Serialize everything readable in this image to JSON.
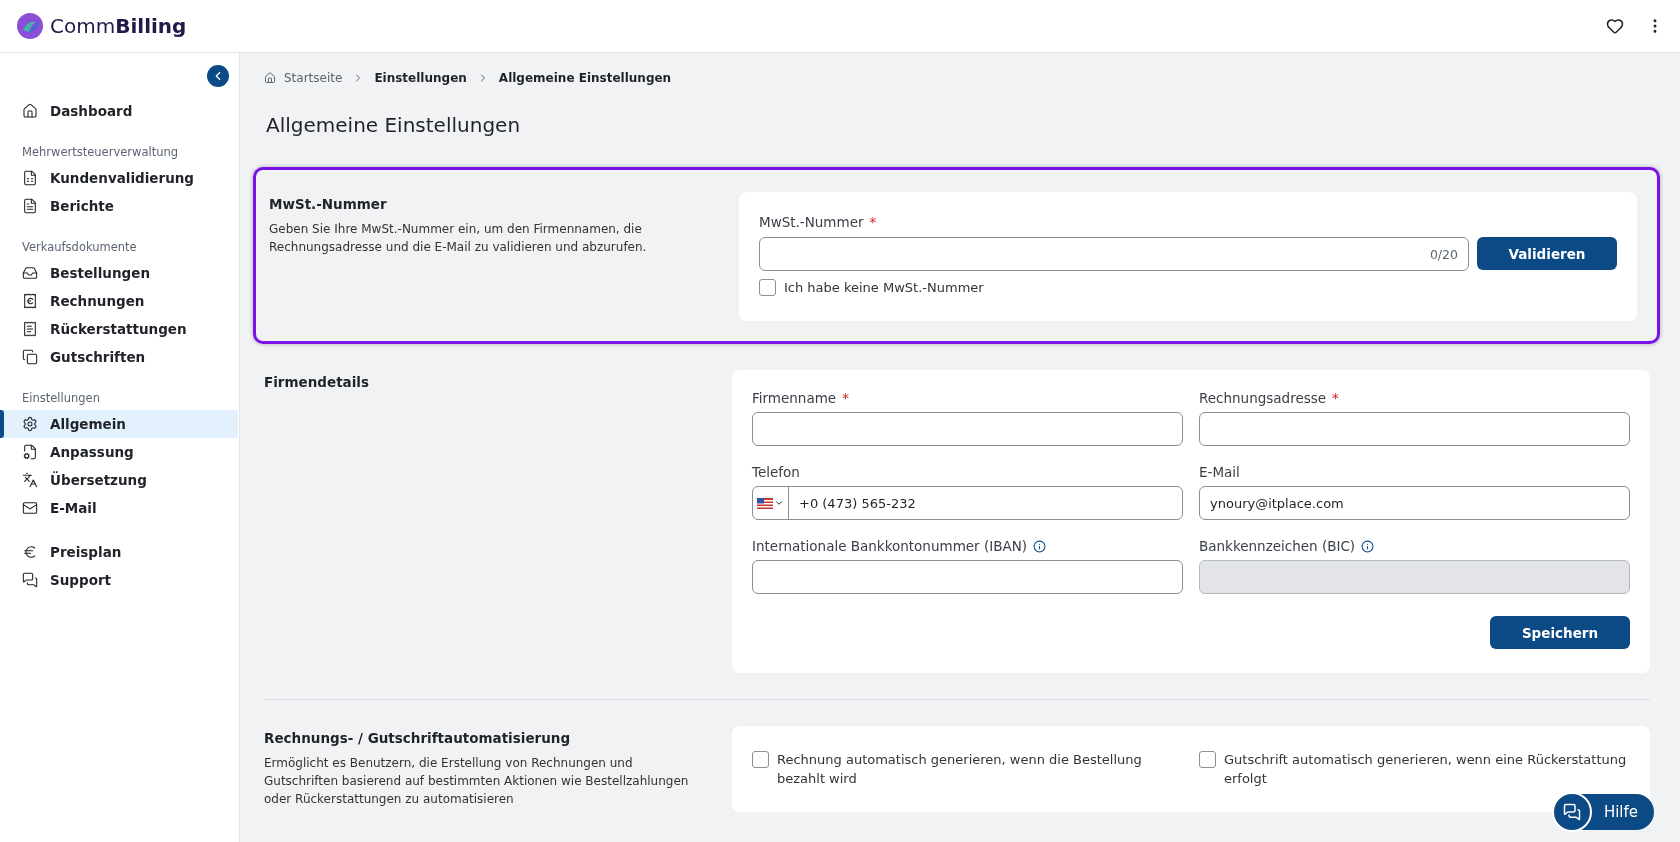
{
  "header": {
    "logo_prefix": "Comm",
    "logo_suffix": "Billing"
  },
  "sidebar": {
    "groups": [
      {
        "items": [
          {
            "label": "Dashboard",
            "selected": false
          }
        ]
      },
      {
        "title": "Mehrwertsteuerverwaltung",
        "items": [
          {
            "label": "Kundenvalidierung",
            "selected": false
          },
          {
            "label": "Berichte",
            "selected": false
          }
        ]
      },
      {
        "title": "Verkaufsdokumente",
        "items": [
          {
            "label": "Bestellungen",
            "selected": false
          },
          {
            "label": "Rechnungen",
            "selected": false
          },
          {
            "label": "Rückerstattungen",
            "selected": false
          },
          {
            "label": "Gutschriften",
            "selected": false
          }
        ]
      },
      {
        "title": "Einstellungen",
        "items": [
          {
            "label": "Allgemein",
            "selected": true
          },
          {
            "label": "Anpassung",
            "selected": false
          },
          {
            "label": "Übersetzung",
            "selected": false
          },
          {
            "label": "E-Mail",
            "selected": false
          }
        ]
      },
      {
        "items": [
          {
            "label": "Preisplan",
            "selected": false
          },
          {
            "label": "Support",
            "selected": false
          }
        ]
      }
    ]
  },
  "breadcrumb": [
    "Startseite",
    "Einstellungen",
    "Allgemeine Einstellungen"
  ],
  "title": "Allgemeine Einstellungen",
  "vat_section": {
    "title": "MwSt.-Nummer",
    "description": "Geben Sie Ihre MwSt.-Nummer ein, um den Firmennamen, die Rechnungsadresse und die E-Mail zu validieren und abzurufen.",
    "highlighted": true,
    "field_label": "MwSt.-Nummer",
    "required_mark": "*",
    "counter": "0/20",
    "button": "Validieren",
    "checkbox": {
      "label": "Ich habe keine MwSt.-Nummer",
      "checked": false
    }
  },
  "company_section": {
    "title": "Firmendetails",
    "fields": [
      {
        "label": "Firmenname",
        "required_mark": "*",
        "kind": "text",
        "disabled": false
      },
      {
        "label": "Rechnungsadresse",
        "required_mark": "*",
        "kind": "text",
        "disabled": false
      },
      {
        "label": "Telefon",
        "kind": "phone",
        "value": "+0 (473) 565-232",
        "disabled": false
      },
      {
        "label": "E-Mail",
        "kind": "text",
        "value": "ynoury@itplace.com",
        "disabled": false
      },
      {
        "label": "Internationale Bankkontonummer (IBAN)",
        "kind": "text",
        "info": true,
        "disabled": false
      },
      {
        "label": "Bankkennzeichen (BIC)",
        "kind": "text",
        "info": true,
        "disabled": true
      }
    ],
    "button": "Speichern"
  },
  "automation_section": {
    "title": "Rechnungs- / Gutschriftautomatisierung",
    "description": "Ermöglicht es Benutzern, die Erstellung von Rechnungen und Gutschriften basierend auf bestimmten Aktionen wie Bestellzahlungen oder Rückerstattungen zu automatisieren",
    "options": [
      {
        "label": "Rechnung automatisch generieren, wenn die Bestellung bezahlt wird",
        "checked": false
      },
      {
        "label": "Gutschrift automatisch generieren, wenn eine Rückerstattung erfolgt",
        "checked": false
      }
    ]
  },
  "help_button": "Hilfe"
}
